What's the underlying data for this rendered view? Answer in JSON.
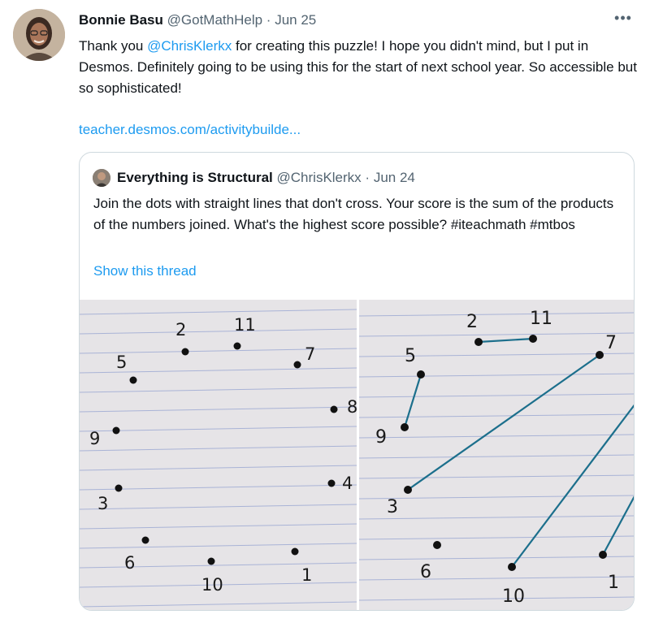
{
  "tweet": {
    "author_name": "Bonnie Basu",
    "handle": "@GotMathHelp",
    "separator": "·",
    "date": "Jun 25",
    "more_label": "•••",
    "text_before": "Thank you ",
    "mention": "@ChrisKlerkx",
    "text_after": " for creating this puzzle! I hope you didn't mind, but I put in Desmos. Definitely going to be using this for the start of next school year.  So accessible but so sophisticated!",
    "link": "teacher.desmos.com/activitybuilde..."
  },
  "quote": {
    "author_name": "Everything is Structural",
    "handle": "@ChrisKlerkx",
    "separator": "·",
    "date": "Jun 24",
    "text": "Join the dots with straight lines that don't cross. Your score is the sum of the products of the numbers joined. What's the highest score possible? #iteachmath #mtbos",
    "show_thread": "Show this thread"
  },
  "photo_labels": {
    "left": [
      "2",
      "11",
      "5",
      "7",
      "8",
      "9",
      "3",
      "4",
      "6",
      "10",
      "1"
    ],
    "right": [
      "2",
      "11",
      "5",
      "7",
      "9",
      "3",
      "6",
      "10",
      "1"
    ]
  },
  "colors": {
    "accent": "#1d9bf0",
    "secondary_text": "#536471",
    "border": "#cfd9de",
    "paper": "#e6e4e7",
    "rule_line": "#a9b3d6",
    "pen_line": "#1c6f8c"
  }
}
